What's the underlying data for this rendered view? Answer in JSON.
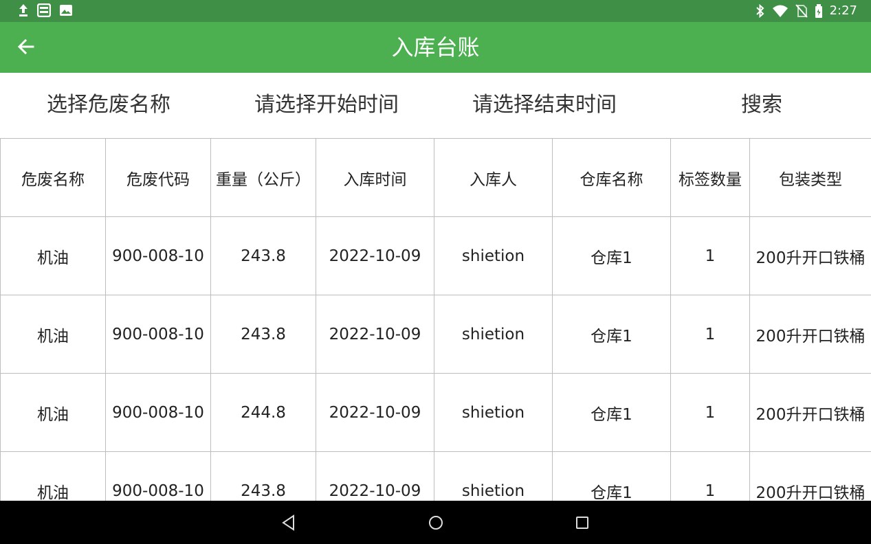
{
  "status_bar": {
    "time": "2:27",
    "left_icons": [
      "upload-icon",
      "sd-card-icon",
      "image-icon"
    ],
    "right_icons": [
      "bluetooth-icon",
      "wifi-icon",
      "no-sim-icon",
      "battery-icon"
    ]
  },
  "app_bar": {
    "title": "入库台账",
    "back_icon": "arrow-back-icon",
    "color": "#4caf50"
  },
  "filters": {
    "waste_name": "选择危废名称",
    "start_time": "请选择开始时间",
    "end_time": "请选择结束时间",
    "search": "搜索"
  },
  "table": {
    "headers": [
      "危废名称",
      "危废代码",
      "重量（公斤）",
      "入库时间",
      "入库人",
      "仓库名称",
      "标签数量",
      "包装类型"
    ],
    "rows": [
      [
        "机油",
        "900-008-10",
        "243.8",
        "2022-10-09",
        "shietion",
        "仓库1",
        "1",
        "200升开口铁桶"
      ],
      [
        "机油",
        "900-008-10",
        "243.8",
        "2022-10-09",
        "shietion",
        "仓库1",
        "1",
        "200升开口铁桶"
      ],
      [
        "机油",
        "900-008-10",
        "244.8",
        "2022-10-09",
        "shietion",
        "仓库1",
        "1",
        "200升开口铁桶"
      ],
      [
        "机油",
        "900-008-10",
        "243.8",
        "2022-10-09",
        "shietion",
        "仓库1",
        "1",
        "200升开口铁桶"
      ]
    ]
  },
  "nav_bar": {
    "buttons": [
      "back-triangle-icon",
      "home-circle-icon",
      "recents-square-icon"
    ]
  }
}
